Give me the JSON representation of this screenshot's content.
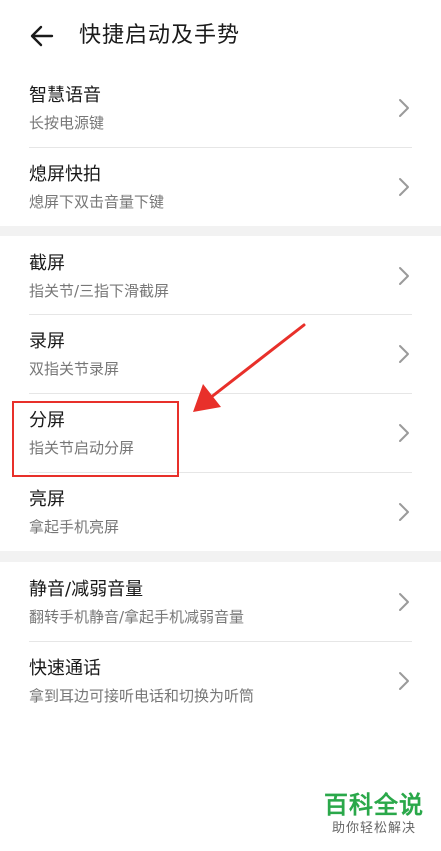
{
  "header": {
    "title": "快捷启动及手势",
    "back_icon": "arrow-left-icon"
  },
  "groups": [
    {
      "items": [
        {
          "label": "智慧语音",
          "sub": "长按电源键"
        },
        {
          "label": "熄屏快拍",
          "sub": "熄屏下双击音量下键"
        }
      ]
    },
    {
      "items": [
        {
          "label": "截屏",
          "sub": "指关节/三指下滑截屏"
        },
        {
          "label": "录屏",
          "sub": "双指关节录屏"
        },
        {
          "label": "分屏",
          "sub": "指关节启动分屏"
        },
        {
          "label": "亮屏",
          "sub": "拿起手机亮屏"
        }
      ]
    },
    {
      "items": [
        {
          "label": "静音/减弱音量",
          "sub": "翻转手机静音/拿起手机减弱音量"
        },
        {
          "label": "快速通话",
          "sub": "拿到耳边可接听电话和切换为听筒"
        }
      ]
    }
  ],
  "annotation": {
    "color": "#e8302a"
  },
  "watermark": {
    "title": "百科全说",
    "subtitle": "助你轻松解决",
    "color": "#2aa84a"
  }
}
